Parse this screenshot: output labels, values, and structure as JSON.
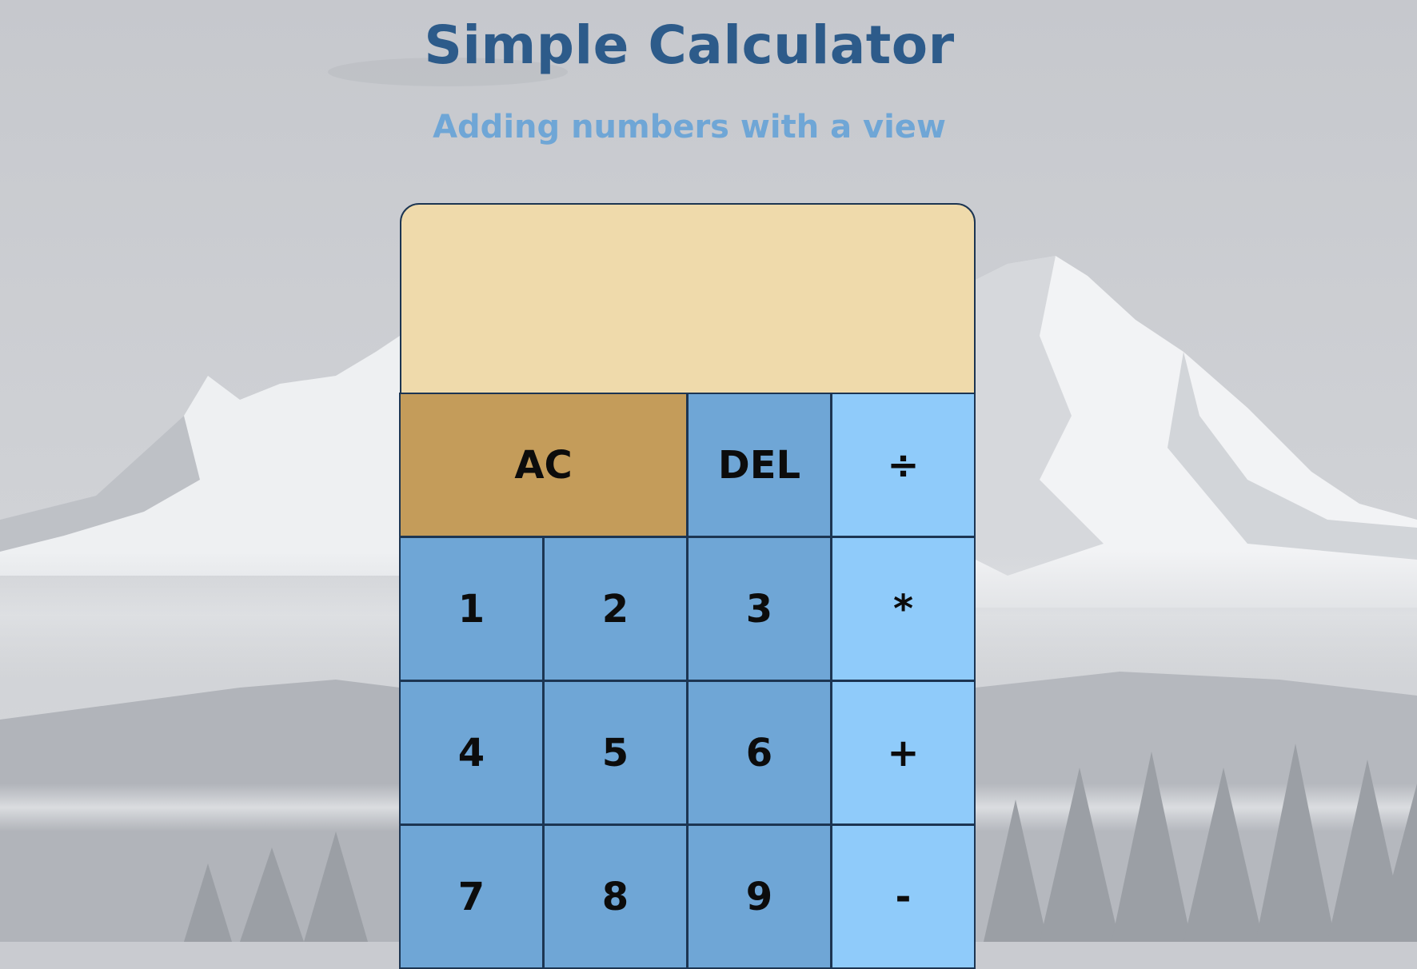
{
  "page": {
    "title": "Simple Calculator",
    "subtitle": "Adding numbers with a view"
  },
  "calculator": {
    "display": {
      "previous_operand": "",
      "current_operand": ""
    },
    "keys": {
      "all_clear": "AC",
      "delete": "DEL",
      "divide": "÷",
      "one": "1",
      "two": "2",
      "three": "3",
      "multiply": "*",
      "four": "4",
      "five": "5",
      "six": "6",
      "add": "+",
      "seven": "7",
      "eight": "8",
      "nine": "9",
      "subtract": "-"
    }
  },
  "colors": {
    "title": "#2d5b8a",
    "subtitle": "#6fa6d6",
    "display_background": "#efdaab",
    "clear_key": "#c49c5a",
    "number_key": "#6fa6d6",
    "operator_key": "#8fcbfa",
    "border": "#1c3552"
  }
}
